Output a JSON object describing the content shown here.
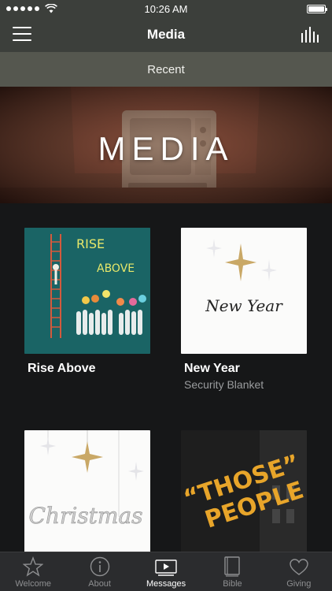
{
  "status_bar": {
    "time": "10:26 AM"
  },
  "nav": {
    "title": "Media"
  },
  "subnav": {
    "label": "Recent"
  },
  "hero": {
    "title": "MEDIA"
  },
  "media_items": [
    {
      "title": "Rise Above",
      "subtitle": "",
      "art_text": [
        "RISE",
        "ABOVE"
      ]
    },
    {
      "title": "New Year",
      "subtitle": "Security Blanket",
      "art_text": "New Year"
    },
    {
      "title": "",
      "subtitle": "",
      "art_text": "Christmas"
    },
    {
      "title": "",
      "subtitle": "",
      "art_text": [
        "“THOSE”",
        "PEOPLE"
      ]
    }
  ],
  "tabs": [
    {
      "label": "Welcome",
      "icon": "star-icon",
      "active": false
    },
    {
      "label": "About",
      "icon": "info-icon",
      "active": false
    },
    {
      "label": "Messages",
      "icon": "play-icon",
      "active": true
    },
    {
      "label": "Bible",
      "icon": "book-icon",
      "active": false
    },
    {
      "label": "Giving",
      "icon": "heart-icon",
      "active": false
    }
  ],
  "colors": {
    "nav_bg": "#3c3f3b",
    "subnav_bg": "#55574f",
    "body_bg": "#161718",
    "tab_bar_bg": "#2b2c2e",
    "accent_orange": "#e8a52a"
  }
}
